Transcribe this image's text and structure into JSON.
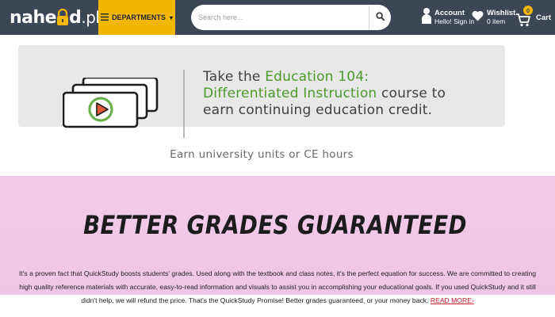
{
  "header": {
    "logo_text": "nahe",
    "logo_text_2": "d",
    "logo_tld": ".pk",
    "departments_label": "DEPARTMENTS",
    "search_placeholder": "Search here...",
    "account_title": "Account",
    "account_sub": "Hello! Sign in",
    "wishlist_title": "Wishlist",
    "wishlist_sub": "0 item",
    "cart_label": "Cart",
    "cart_count": "0",
    "colors": {
      "bar": "#3d4654",
      "accent": "#f2b705"
    },
    "icons": [
      "hamburger-icon",
      "caret-down-icon",
      "search-icon",
      "user-icon",
      "heart-icon",
      "cart-icon"
    ]
  },
  "promo": {
    "text_before": "Take the ",
    "course_name": "Education 104: Differentiated Instruction",
    "text_after": " course to earn continuing education credit.",
    "subtitle": "Earn university units or CE hours",
    "icon": "video-play-icon",
    "highlight_color": "#4a9a2a"
  },
  "guarantee": {
    "heading": "BETTER GRADES GUARANTEED",
    "body": "It's a proven fact that QuickStudy boosts students' grades. Used along with the textbook and class notes, it's the perfect equation for success. We are committed to creating high quality reference materials with accurate, easy-to-read information and visuals to assist you in accomplishing your educational goals. If you used QuickStudy and it still didn't help, we will refund the price. That's the QuickStudy Promise! Better grades guaranteed, or your money back.",
    "read_more": "READ MORE",
    "background": "#f1c9e7"
  }
}
